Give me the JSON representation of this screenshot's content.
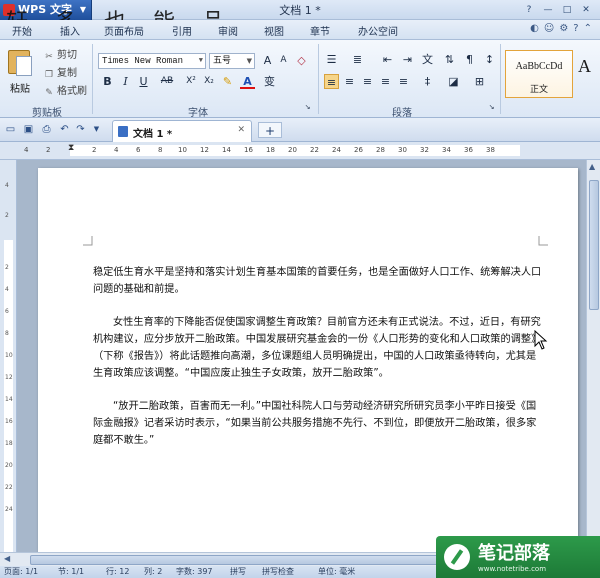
{
  "titlebar": {
    "app_name": "WPS 文字",
    "doc_title": "文档 1 *",
    "watermark": "轩 多 也 能 品"
  },
  "menu": {
    "tabs": [
      "开始",
      "插入",
      "页面布局",
      "引用",
      "审阅",
      "视图",
      "章节",
      "办公空间"
    ]
  },
  "ribbon": {
    "clipboard": {
      "paste_label": "粘贴",
      "cut_label": "剪切",
      "copy_label": "复制",
      "format_painter_label": "格式刷",
      "group_label": "剪贴板"
    },
    "font": {
      "font_name": "Times New Roman",
      "font_size": "五号",
      "group_label": "字体",
      "bold": "B",
      "italic": "I",
      "underline": "U",
      "strike": "AB",
      "super": "X²",
      "sub": "X₂",
      "color_a": "A",
      "phonetic": "变"
    },
    "paragraph": {
      "group_label": "段落"
    },
    "styles": {
      "sample": "AaBbCcDd",
      "name": "正文",
      "next_sample": "A"
    }
  },
  "doc_tabs": {
    "active_tab": "文档 1 *",
    "new_tab": "+"
  },
  "ruler": {
    "h_ticks": [
      "4",
      "2",
      "2",
      "4",
      "6",
      "8",
      "10",
      "12",
      "14",
      "16",
      "18",
      "20",
      "22",
      "24",
      "26",
      "28",
      "30",
      "32",
      "34",
      "36",
      "38"
    ],
    "v_ticks": [
      "4",
      "2",
      "2",
      "4",
      "6",
      "8",
      "10",
      "12",
      "14",
      "16",
      "18",
      "20",
      "22",
      "24"
    ]
  },
  "document": {
    "paragraphs": [
      "稳定低生育水平是坚持和落实计划生育基本国策的首要任务，也是全面做好人口工作、统筹解决人口问题的基础和前提。",
      "女性生育率的下降能否促使国家调整生育政策？目前官方还未有正式说法。不过，近日，有研究机构建议，应分步放开二胎政策。中国发展研究基金会的一份《人口形势的变化和人口政策的调整》（下称《报告》）将此话题推向高潮，多位课题组人员明确提出，中国的人口政策亟待转向，尤其是生育政策应该调整。“中国应废止独生子女政策，放开二胎政策”。",
      "“放开二胎政策，百害而无一利。”中国社科院人口与劳动经济研究所研究员李小平昨日接受《国际金融报》记者采访时表示，“如果当前公共服务措施不先行、不到位，即便放开二胎政策，很多家庭都不敢生。”"
    ]
  },
  "statusbar": {
    "page": "页面: 1/1",
    "section": "节: 1/1",
    "row": "行: 12",
    "col": "列: 2",
    "words": "字数: 397",
    "spell": "拼写",
    "check": "拼写检查",
    "unit": "单位: 毫米"
  },
  "badge": {
    "title": "笔记部落",
    "url": "www.notetribe.com"
  },
  "colors": {
    "accent": "#1f4f9c",
    "badge_green": "#2d9a4a",
    "style_border": "#e3a43b"
  }
}
